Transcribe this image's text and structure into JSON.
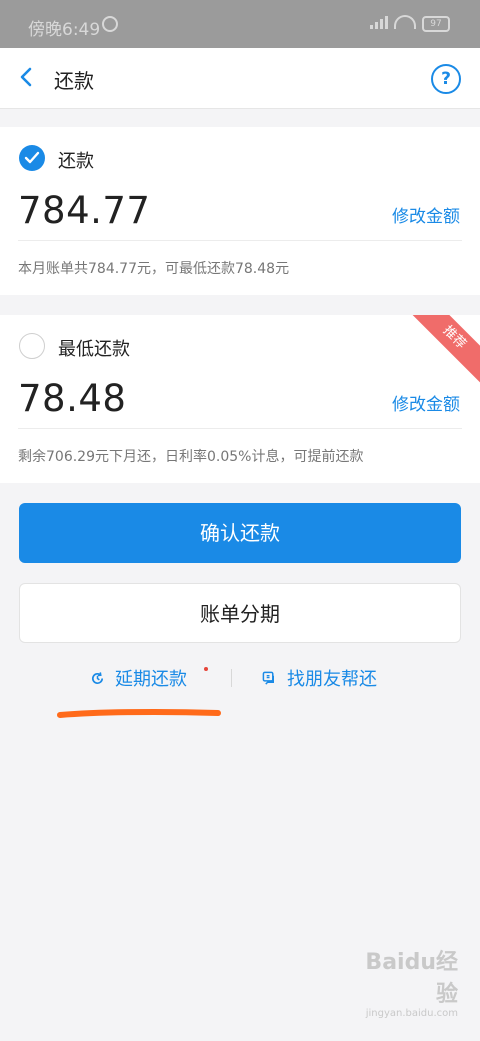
{
  "status_bar": {
    "time": "傍晚6:49",
    "battery": "97"
  },
  "nav": {
    "title": "还款",
    "back_icon": "chevron-left-icon",
    "help_icon": "question-circle-icon",
    "help_glyph": "?"
  },
  "full_payment": {
    "selected": true,
    "label": "还款",
    "amount": "784.77",
    "edit_label": "修改金额",
    "note": "本月账单共784.77元，可最低还款78.48元"
  },
  "min_payment": {
    "selected": false,
    "label": "最低还款",
    "badge": "推荐",
    "amount": "78.48",
    "edit_label": "修改金额",
    "note": "剩余706.29元下月还，日利率0.05%计息，可提前还款"
  },
  "actions": {
    "confirm_label": "确认还款",
    "installment_label": "账单分期"
  },
  "links": {
    "deferred_label": "延期还款",
    "deferred_icon": "clock-refresh-icon",
    "friend_label": "找朋友帮还",
    "friend_icon": "chat-icon"
  },
  "watermark": {
    "brand": "Baidu经验",
    "url": "jingyan.baidu.com"
  },
  "colors": {
    "accent": "#1a8ae6",
    "badge": "#f06c6a",
    "annotation": "#ff6a1a"
  }
}
